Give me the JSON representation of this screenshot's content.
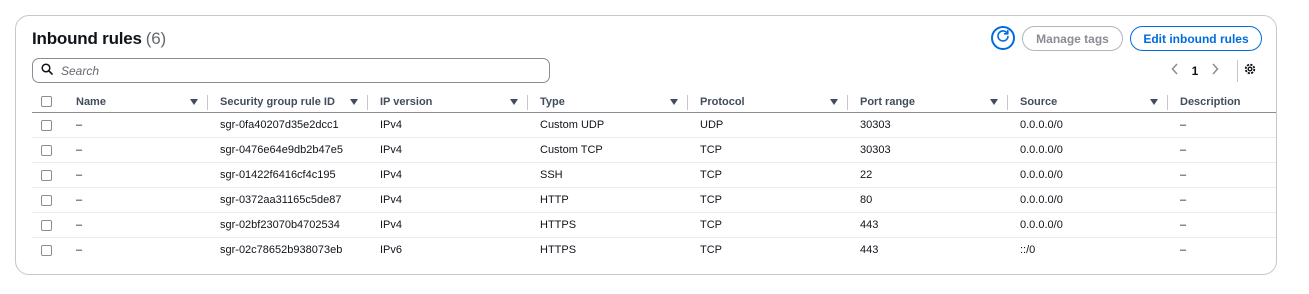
{
  "header": {
    "title": "Inbound rules",
    "count": "(6)",
    "manage_tags_label": "Manage tags",
    "edit_label": "Edit inbound rules"
  },
  "search": {
    "placeholder": "Search"
  },
  "pagination": {
    "current_page": "1"
  },
  "table": {
    "columns": [
      "Name",
      "Security group rule ID",
      "IP version",
      "Type",
      "Protocol",
      "Port range",
      "Source",
      "Description"
    ],
    "rows": [
      {
        "name": "–",
        "rule_id": "sgr-0fa40207d35e2dcc1",
        "ip_version": "IPv4",
        "type": "Custom UDP",
        "protocol": "UDP",
        "port_range": "30303",
        "source": "0.0.0.0/0",
        "description": "–"
      },
      {
        "name": "–",
        "rule_id": "sgr-0476e64e9db2b47e5",
        "ip_version": "IPv4",
        "type": "Custom TCP",
        "protocol": "TCP",
        "port_range": "30303",
        "source": "0.0.0.0/0",
        "description": "–"
      },
      {
        "name": "–",
        "rule_id": "sgr-01422f6416cf4c195",
        "ip_version": "IPv4",
        "type": "SSH",
        "protocol": "TCP",
        "port_range": "22",
        "source": "0.0.0.0/0",
        "description": "–"
      },
      {
        "name": "–",
        "rule_id": "sgr-0372aa31165c5de87",
        "ip_version": "IPv4",
        "type": "HTTP",
        "protocol": "TCP",
        "port_range": "80",
        "source": "0.0.0.0/0",
        "description": "–"
      },
      {
        "name": "–",
        "rule_id": "sgr-02bf23070b4702534",
        "ip_version": "IPv4",
        "type": "HTTPS",
        "protocol": "TCP",
        "port_range": "443",
        "source": "0.0.0.0/0",
        "description": "–"
      },
      {
        "name": "–",
        "rule_id": "sgr-02c78652b938073eb",
        "ip_version": "IPv6",
        "type": "HTTPS",
        "protocol": "TCP",
        "port_range": "443",
        "source": "::/0",
        "description": "–"
      }
    ]
  },
  "icons": {
    "refresh": "refresh-icon",
    "search": "search-icon",
    "prev": "chevron-left-icon",
    "next": "chevron-right-icon",
    "settings": "gear-icon",
    "sort": "caret-down-icon"
  },
  "colors": {
    "accent": "#006ce0",
    "border": "#c6c6cd",
    "text": "#0f141a",
    "muted": "#656871"
  }
}
